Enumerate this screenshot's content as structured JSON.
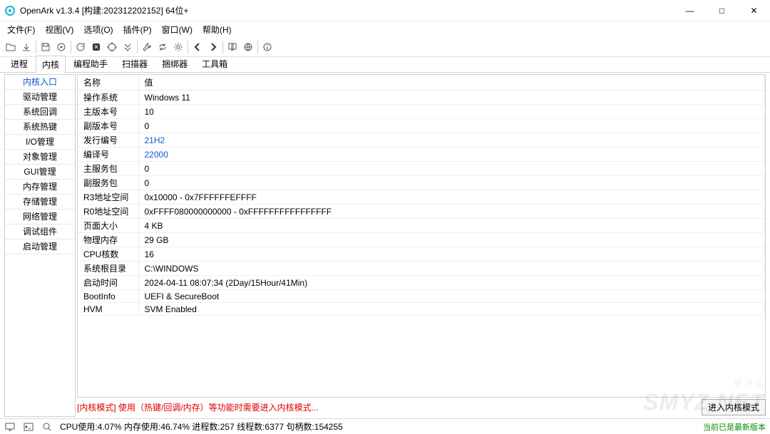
{
  "window": {
    "title": "OpenArk v1.3.4 [构建:202312202152]  64位+",
    "controls": {
      "min": "—",
      "max": "□",
      "close": "✕"
    }
  },
  "menu": [
    "文件(F)",
    "视图(V)",
    "选项(O)",
    "插件(P)",
    "窗口(W)",
    "帮助(H)"
  ],
  "tabs": [
    "进程",
    "内核",
    "编程助手",
    "扫描器",
    "捆绑器",
    "工具箱"
  ],
  "active_tab": "内核",
  "sidebar": [
    "内核入口",
    "驱动管理",
    "系统回调",
    "系统热键",
    "I/O管理",
    "对象管理",
    "GUI管理",
    "内存管理",
    "存储管理",
    "网络管理",
    "调试组件",
    "启动管理"
  ],
  "active_side": "内核入口",
  "grid": {
    "headers": [
      "名称",
      "值"
    ],
    "rows": [
      {
        "name": "操作系统",
        "value": "Windows 11"
      },
      {
        "name": "主版本号",
        "value": "10"
      },
      {
        "name": "副版本号",
        "value": "0"
      },
      {
        "name": "发行编号",
        "value": "21H2",
        "link": true
      },
      {
        "name": "编译号",
        "value": "22000",
        "link": true
      },
      {
        "name": "主服务包",
        "value": "0"
      },
      {
        "name": "副服务包",
        "value": "0"
      },
      {
        "name": "R3地址空间",
        "value": "0x10000 - 0x7FFFFFFEFFFF"
      },
      {
        "name": "R0地址空间",
        "value": "0xFFFF080000000000 - 0xFFFFFFFFFFFFFFFF"
      },
      {
        "name": "页面大小",
        "value": "4 KB"
      },
      {
        "name": "物理内存",
        "value": "29 GB"
      },
      {
        "name": "CPU核数",
        "value": "16"
      },
      {
        "name": "系统根目录",
        "value": "C:\\WINDOWS"
      },
      {
        "name": "启动时间",
        "value": "2024-04-11 08:07:34 (2Day/15Hour/41Min)"
      },
      {
        "name": "BootInfo",
        "value": "UEFI & SecureBoot"
      },
      {
        "name": "HVM",
        "value": "SVM Enabled"
      }
    ]
  },
  "hint": "[内核模式] 使用（热键/回调/内存）等功能时需要进入内核模式...",
  "enter_button": "进入内核模式",
  "status": {
    "text": "CPU使用:4.07%  内存使用:46.74%  进程数:257  线程数:6377  句柄数:154255",
    "version_note": "当前已是最新版本"
  },
  "watermark": {
    "big": "SMYZ.NET",
    "small": "值 什么"
  }
}
